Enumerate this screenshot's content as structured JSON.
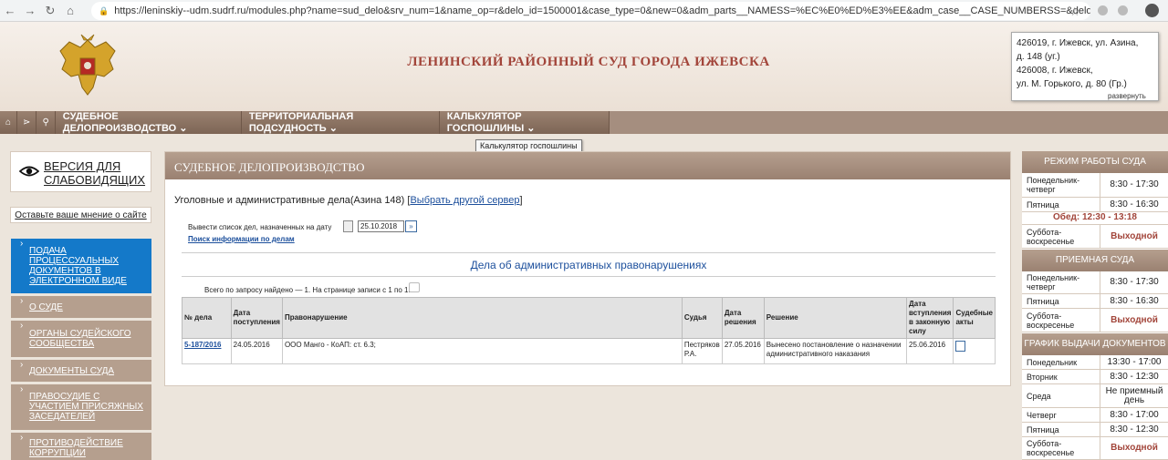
{
  "browser": {
    "url": "https://leninskiy--udm.sudrf.ru/modules.php?name=sud_delo&srv_num=1&name_op=r&delo_id=1500001&case_type=0&new=0&adm_parts__NAMESS=%EC%E0%ED%E3%EE&adm_case__CASE_NUMBERSS=&delo_table=adm_case&adm..."
  },
  "header": {
    "title": "ЛЕНИНСКИЙ РАЙОННЫЙ СУД ГОРОДА ИЖЕВСКА",
    "address": [
      "426019, г. Ижевск, ул. Азина,",
      "д. 148 (уг.)",
      "426008, г. Ижевск,",
      "ул. М. Горького, д. 80 (Гр.)"
    ],
    "expand": "развернуть"
  },
  "nav": {
    "items": [
      "СУДЕБНОЕ ДЕЛОПРОИЗВОДСТВО ⌄",
      "ТЕРРИТОРИАЛЬНАЯ ПОДСУДНОСТЬ ⌄",
      "КАЛЬКУЛЯТОР ГОСПОШЛИНЫ ⌄"
    ],
    "tooltip": "Калькулятор госпошлины"
  },
  "left": {
    "visually_impaired": "ВЕРСИЯ ДЛЯ СЛАБОВИДЯЩИХ",
    "feedback": "Оставьте ваше мнение о сайте",
    "menu": [
      "ПОДАЧА ПРОЦЕССУАЛЬНЫХ ДОКУМЕНТОВ В ЭЛЕКТРОННОМ ВИДЕ",
      "О СУДЕ",
      "ОРГАНЫ СУДЕЙСКОГО СООБЩЕСТВА",
      "ДОКУМЕНТЫ СУДА",
      "ПРАВОСУДИЕ С УЧАСТИЕМ ПРИСЯЖНЫХ ЗАСЕДАТЕЛЕЙ",
      "ПРОТИВОДЕЙСТВИЕ КОРРУПЦИИ"
    ]
  },
  "main": {
    "heading": "СУДЕБНОЕ ДЕЛОПРОИЗВОДСТВО",
    "cases_type": "Уголовные и административные дела(Азина 148) [",
    "change_server": "Выбрать другой сервер",
    "cases_type_end": "]",
    "date_label": "Вывести список дел, назначенных на дату",
    "date_value": "25.10.2018",
    "search_info": "Поиск информации по делам",
    "section_title": "Дела об административных правонарушениях",
    "found": "Всего по запросу найдено — 1. На странице записи с 1 по 1.",
    "columns": [
      "№ дела",
      "Дата поступления",
      "Правонарушение",
      "Судья",
      "Дата решения",
      "Решение",
      "Дата вступления в законную силу",
      "Судебные акты"
    ],
    "rows": [
      {
        "case_no": "5-187/2016",
        "received": "24.05.2016",
        "offense": "ООО Манго - КоАП: ст. 6.3;",
        "judge": "Пестряков Р.А.",
        "decision_date": "27.05.2016",
        "decision": "Вынесено постановление о назначении административного наказания",
        "effective_date": "25.06.2016"
      }
    ]
  },
  "right": {
    "work_title": "РЕЖИМ РАБОТЫ СУДА",
    "work": [
      {
        "d": "Понедельник-четверг",
        "t": "8:30 - 17:30"
      },
      {
        "d": "Пятница",
        "t": "8:30 - 16:30"
      }
    ],
    "lunch": "Обед: 12:30 - 13:18",
    "work_weekend": {
      "d": "Суббота-воскресенье",
      "t": "Выходной"
    },
    "reception_title": "ПРИЕМНАЯ СУДА",
    "reception": [
      {
        "d": "Понедельник-четверг",
        "t": "8:30 - 17:30"
      },
      {
        "d": "Пятница",
        "t": "8:30 - 16:30"
      },
      {
        "d": "Суббота-воскресенье",
        "t": "Выходной"
      }
    ],
    "docs_title": "ГРАФИК ВЫДАЧИ ДОКУМЕНТОВ",
    "docs": [
      {
        "d": "Понедельник",
        "t": "13:30 - 17:00"
      },
      {
        "d": "Вторник",
        "t": "8:30 - 12:30"
      },
      {
        "d": "Среда",
        "t": "Не приемный день"
      },
      {
        "d": "Четверг",
        "t": "8:30 - 17:00"
      },
      {
        "d": "Пятница",
        "t": "8:30 - 12:30"
      },
      {
        "d": "Суббота-воскресенье",
        "t": "Выходной"
      }
    ]
  }
}
